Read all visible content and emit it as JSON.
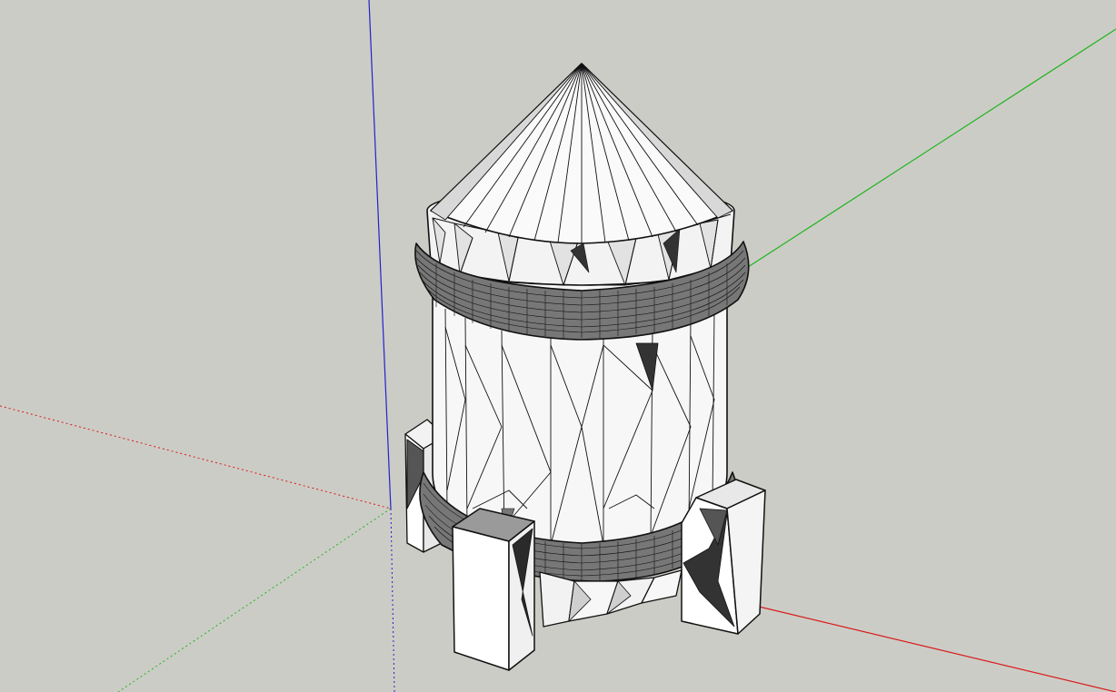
{
  "viewport": {
    "background": "#ccccc6",
    "axis_colors": {
      "red": "#d81c1c",
      "green": "#1fb51f",
      "blue": "#2222cc"
    },
    "model": "wireframe-tower"
  }
}
